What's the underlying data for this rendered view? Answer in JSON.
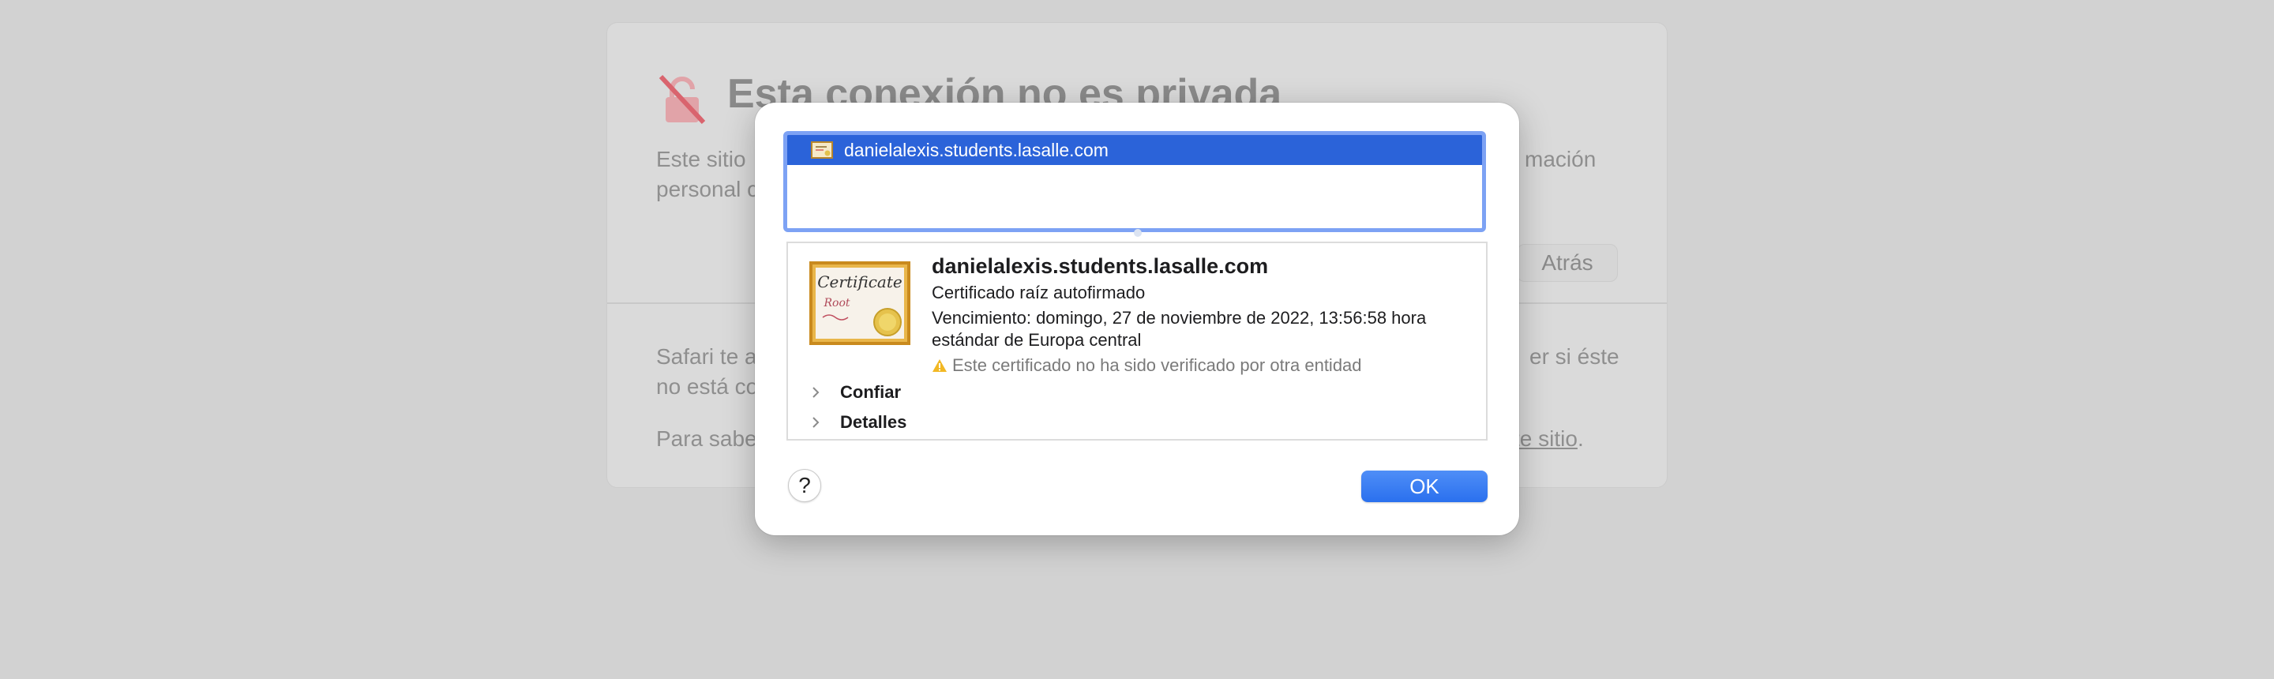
{
  "background_page": {
    "title": "Esta conexión no es privada",
    "line1_left": "Este sitio",
    "line1_right": "mación",
    "line2_left": "personal c",
    "back_button": "Atrás",
    "para1_left": "Safari te a",
    "para1_right": "er si éste",
    "para2_left": "no está co",
    "para3_left": "Para sabe",
    "para3_link": "te sitio",
    "para3_end": "."
  },
  "dialog": {
    "certificate_list": [
      {
        "label": "danielalexis.students.lasalle.com",
        "selected": true
      }
    ],
    "details": {
      "name": "danielalexis.students.lasalle.com",
      "type": "Certificado raíz autofirmado",
      "expiry_line1": "Vencimiento: domingo, 27 de noviembre de 2022, 13:56:58 hora",
      "expiry_line2": "estándar de Europa central",
      "warning": "Este certificado no ha sido verificado por otra entidad",
      "image_text_1": "Certificate",
      "image_text_2": "Root"
    },
    "sections": {
      "trust": "Confiar",
      "details": "Detalles"
    },
    "help_button": "?",
    "ok_button": "OK"
  },
  "colors": {
    "selection": "#2b63d9",
    "focus_ring": "#7da2f4",
    "ok_button": "#3a7ff3",
    "warning_icon": "#f2b824",
    "lock_icon": "#d9646e"
  }
}
